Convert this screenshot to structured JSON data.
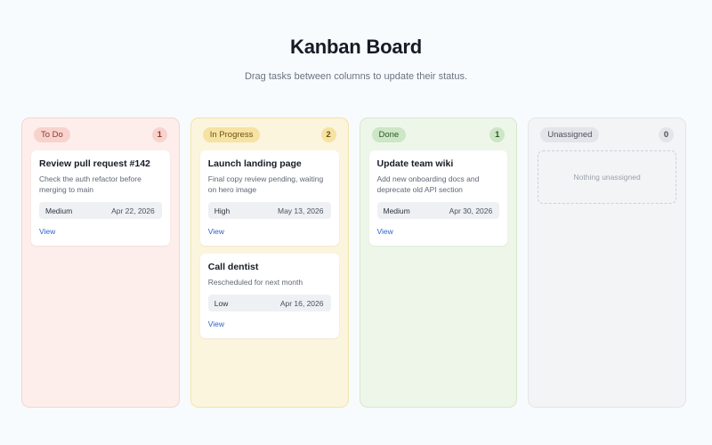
{
  "header": {
    "title": "Kanban Board",
    "subtitle": "Drag tasks between columns to update their status."
  },
  "columns": [
    {
      "label": "To Do",
      "count": "1",
      "color": "#fdeeec",
      "cards": [
        {
          "title": "Review pull request #142",
          "description": "Check the auth refactor before merging to main",
          "priority": "Medium",
          "date": "Apr 22, 2026",
          "link": "View"
        }
      ]
    },
    {
      "label": "In Progress",
      "count": "2",
      "color": "#fcf5de",
      "cards": [
        {
          "title": "Launch landing page",
          "description": "Final copy review pending, waiting on hero image",
          "priority": "High",
          "date": "May 13, 2026",
          "link": "View"
        },
        {
          "title": "Call dentist",
          "description": "Rescheduled for next month",
          "priority": "Low",
          "date": "Apr 16, 2026",
          "link": "View"
        }
      ]
    },
    {
      "label": "Done",
      "count": "1",
      "color": "#eef6ea",
      "cards": [
        {
          "title": "Update team wiki",
          "description": "Add new onboarding docs and deprecate old API section",
          "priority": "Medium",
          "date": "Apr 30, 2026",
          "link": "View"
        }
      ]
    },
    {
      "label": "Unassigned",
      "count": "0",
      "color": "#f3f4f6",
      "empty_text": "Nothing unassigned"
    }
  ]
}
